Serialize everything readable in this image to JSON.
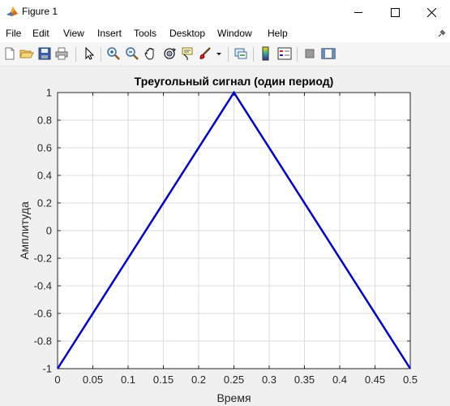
{
  "window": {
    "title": "Figure 1",
    "icon": "matlab-icon"
  },
  "title_bar_buttons": [
    "minimize-icon",
    "maximize-icon",
    "close-icon"
  ],
  "menu": {
    "items": [
      "File",
      "Edit",
      "View",
      "Insert",
      "Tools",
      "Desktop",
      "Window",
      "Help"
    ]
  },
  "toolbar": {
    "buttons": [
      "new-figure-icon",
      "open-file-icon",
      "save-icon",
      "print-icon",
      "edit-plot-icon",
      "zoom-in-icon",
      "zoom-out-icon",
      "pan-icon",
      "rotate-3d-icon",
      "data-cursor-icon",
      "brush-icon",
      "brush-dropdown-icon",
      "link-plot-icon",
      "insert-colorbar-icon",
      "insert-legend-icon",
      "hide-plot-tools-icon",
      "show-plot-tools-icon"
    ]
  },
  "colors": {
    "line": "#0000d4",
    "grid": "#dcdcdc",
    "axes_bg": "#ffffff",
    "figure_bg": "#f0f0f0"
  },
  "chart_data": {
    "type": "line",
    "title": "Треугольный сигнал (один период)",
    "xlabel": "Время",
    "ylabel": "Амплитуда",
    "xlim": [
      0,
      0.5
    ],
    "ylim": [
      -1,
      1
    ],
    "grid": true,
    "xticks": [
      0,
      0.05,
      0.1,
      0.15,
      0.2,
      0.25,
      0.3,
      0.35,
      0.4,
      0.45,
      0.5
    ],
    "xtick_labels": [
      "0",
      "0.05",
      "0.1",
      "0.15",
      "0.2",
      "0.25",
      "0.3",
      "0.35",
      "0.4",
      "0.45",
      "0.5"
    ],
    "yticks": [
      -1,
      -0.8,
      -0.6,
      -0.4,
      -0.2,
      0,
      0.2,
      0.4,
      0.6,
      0.8,
      1
    ],
    "ytick_labels": [
      "-1",
      "-0.8",
      "-0.6",
      "-0.4",
      "-0.2",
      "0",
      "0.2",
      "0.4",
      "0.6",
      "0.8",
      "1"
    ],
    "series": [
      {
        "x": [
          0,
          0.25,
          0.5
        ],
        "y": [
          -1,
          1,
          -1
        ]
      }
    ]
  }
}
